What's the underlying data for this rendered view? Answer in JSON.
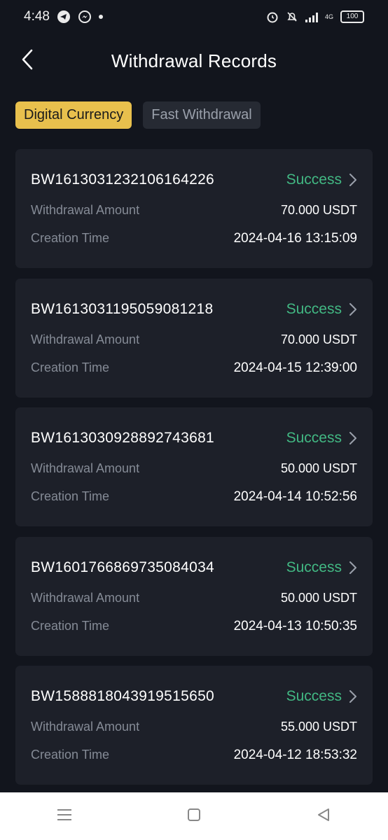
{
  "status_bar": {
    "time": "4:48",
    "network": "4G",
    "battery": "100",
    "icons": [
      "telegram-icon",
      "messenger-icon",
      "dot-icon",
      "alarm-icon",
      "silent-icon",
      "signal-icon",
      "signal-4g-icon",
      "battery-icon"
    ]
  },
  "header": {
    "title": "Withdrawal Records",
    "back_icon": "chevron-left-icon"
  },
  "tabs": [
    {
      "label": "Digital Currency",
      "active": true
    },
    {
      "label": "Fast Withdrawal",
      "active": false
    }
  ],
  "labels": {
    "amount": "Withdrawal Amount",
    "time": "Creation Time"
  },
  "records": [
    {
      "id": "BW1613031232106164226",
      "status": "Success",
      "amount": "70.000 USDT",
      "created": "2024-04-16 13:15:09"
    },
    {
      "id": "BW1613031195059081218",
      "status": "Success",
      "amount": "70.000 USDT",
      "created": "2024-04-15 12:39:00"
    },
    {
      "id": "BW1613030928892743681",
      "status": "Success",
      "amount": "50.000 USDT",
      "created": "2024-04-14 10:52:56"
    },
    {
      "id": "BW1601766869735084034",
      "status": "Success",
      "amount": "50.000 USDT",
      "created": "2024-04-13 10:50:35"
    },
    {
      "id": "BW1588818043919515650",
      "status": "Success",
      "amount": "55.000 USDT",
      "created": "2024-04-12 18:53:32"
    }
  ],
  "colors": {
    "background": "#12151d",
    "card": "#1d2029",
    "accent": "#e8c04d",
    "success": "#42b883",
    "muted": "#858b96"
  },
  "nav_bar": {
    "icons": [
      "menu-icon",
      "home-square-icon",
      "back-triangle-icon"
    ]
  }
}
